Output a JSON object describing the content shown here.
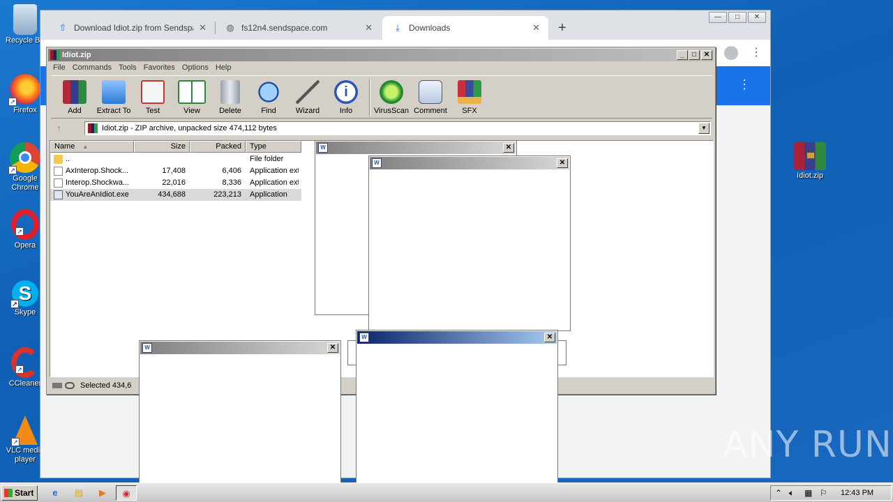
{
  "desktop": {
    "icons": [
      {
        "label": "Recycle Bin"
      },
      {
        "label": "Firefox"
      },
      {
        "label": "Google Chrome"
      },
      {
        "label": "Opera"
      },
      {
        "label": "Skype"
      },
      {
        "label": "CCleaner"
      },
      {
        "label": "VLC media player"
      },
      {
        "label": "Idiot.zip"
      }
    ]
  },
  "browser": {
    "tabs": [
      {
        "title": "Download Idiot.zip from Sendspace.c",
        "icon": "upload-arrow-icon"
      },
      {
        "title": "fs12n4.sendspace.com",
        "icon": "globe-icon"
      },
      {
        "title": "Downloads",
        "icon": "download-icon"
      }
    ],
    "new_tab": "+",
    "caption": {
      "min": "—",
      "max": "□",
      "close": "✕"
    }
  },
  "winrar": {
    "title": "Idiot.zip",
    "menu": [
      "File",
      "Commands",
      "Tools",
      "Favorites",
      "Options",
      "Help"
    ],
    "toolbar": [
      "Add",
      "Extract To",
      "Test",
      "View",
      "Delete",
      "Find",
      "Wizard",
      "Info",
      "VirusScan",
      "Comment",
      "SFX"
    ],
    "address": "Idiot.zip - ZIP archive, unpacked size 474,112 bytes",
    "columns": [
      "Name",
      "Size",
      "Packed",
      "Type"
    ],
    "files": [
      {
        "name": "..",
        "size": "",
        "packed": "",
        "type": "File folder"
      },
      {
        "name": "AxInterop.Shock...",
        "size": "17,408",
        "packed": "6,406",
        "type": "Application ext"
      },
      {
        "name": "Interop.Shockwa...",
        "size": "22,016",
        "packed": "8,336",
        "type": "Application ext"
      },
      {
        "name": "YouAreAnIdiot.exe",
        "size": "434,688",
        "packed": "223,213",
        "type": "Application"
      }
    ],
    "status": "Selected 434,6"
  },
  "taskbar": {
    "start": "Start",
    "clock": "12:43 PM"
  },
  "watermark": "ANY RUN"
}
